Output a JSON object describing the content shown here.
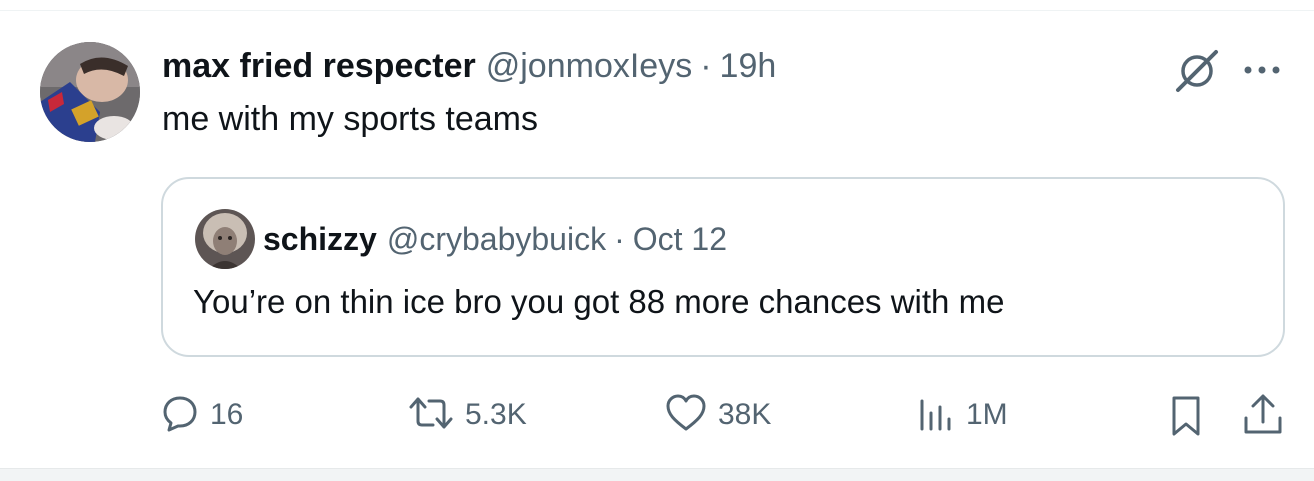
{
  "tweet": {
    "display_name": "max fried respecter",
    "handle": "@jonmoxIeys",
    "separator": "·",
    "time": "19h",
    "text": "me with my sports teams"
  },
  "quote": {
    "display_name": "schizzy",
    "handle": "@crybabybuick",
    "separator": "·",
    "time": "Oct 12",
    "text": "You’re on thin ice bro you got 88 more chances with me"
  },
  "actions": {
    "replies": "16",
    "reposts": "5.3K",
    "likes": "38K",
    "views": "1M"
  },
  "icons": [
    "grok-icon",
    "more-icon",
    "reply-icon",
    "repost-icon",
    "like-icon",
    "views-icon",
    "bookmark-icon",
    "share-icon"
  ],
  "colors": {
    "text_primary": "#0f1419",
    "text_secondary": "#536471",
    "border": "#cfd9de"
  }
}
